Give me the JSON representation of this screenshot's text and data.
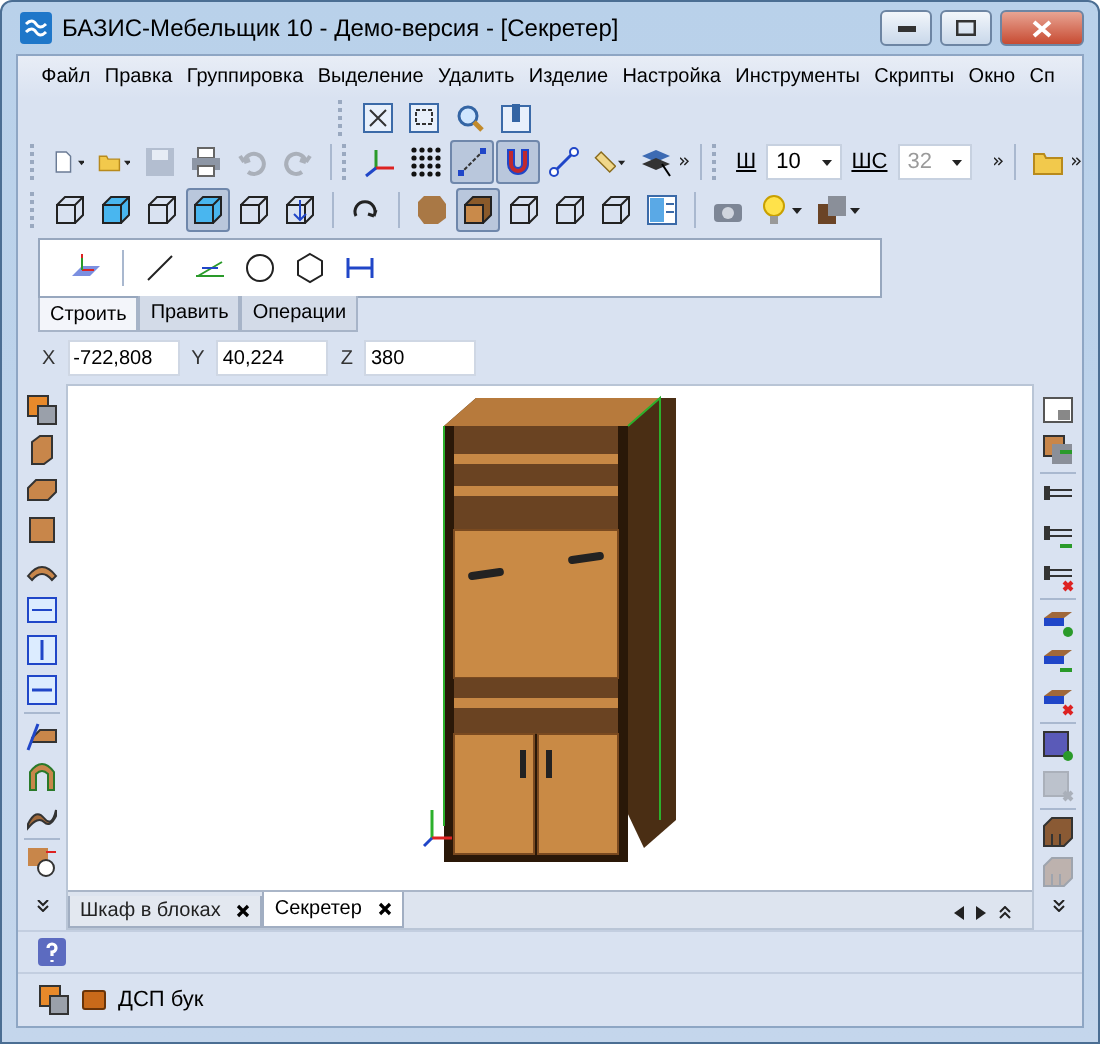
{
  "window": {
    "title": "БАЗИС-Мебельщик 10 - Демо-версия - [Секретер]"
  },
  "menu": [
    "Файл",
    "Правка",
    "Группировка",
    "Выделение",
    "Удалить",
    "Изделие",
    "Настройка",
    "Инструменты",
    "Скрипты",
    "Окно",
    "Сп"
  ],
  "toolbar_top": [
    {
      "kind": "fit",
      "pressed": false
    },
    {
      "kind": "zoomwin",
      "pressed": false
    },
    {
      "kind": "zoom",
      "pressed": false
    },
    {
      "kind": "pan",
      "pressed": false
    }
  ],
  "toolbar_file": [
    {
      "kind": "document",
      "pressed": false,
      "menu": true
    },
    {
      "kind": "folder",
      "pressed": false,
      "menu": true
    },
    {
      "kind": "floppy",
      "pressed": false,
      "disabled": true
    },
    {
      "kind": "printer",
      "pressed": false
    },
    {
      "kind": "undo",
      "pressed": false,
      "disabled": true
    },
    {
      "kind": "redo",
      "pressed": false,
      "disabled": true
    }
  ],
  "toolbar_snap": [
    {
      "kind": "axes",
      "pressed": false
    },
    {
      "kind": "dots",
      "pressed": false
    },
    {
      "kind": "snap",
      "pressed": true
    },
    {
      "kind": "magnet",
      "pressed": true
    },
    {
      "kind": "segment",
      "pressed": false
    },
    {
      "kind": "ruler",
      "pressed": false,
      "menu": true
    },
    {
      "kind": "layers",
      "pressed": false
    }
  ],
  "step_fields": [
    {
      "label": "Ш",
      "value": "10",
      "disabled": false
    },
    {
      "label": "ШС",
      "value": "32",
      "disabled": true
    }
  ],
  "toolbar_view": [
    {
      "kind": "wirecube",
      "pressed": false
    },
    {
      "kind": "bluecube",
      "pressed": false
    },
    {
      "kind": "wirecube",
      "pressed": false
    },
    {
      "kind": "bluecube",
      "pressed": true
    },
    {
      "kind": "wirecube",
      "pressed": false
    },
    {
      "kind": "cubearrows",
      "pressed": false
    },
    {
      "kind": "rotate",
      "pressed": false
    },
    {
      "kind": "woodtexture",
      "pressed": false
    },
    {
      "kind": "woodcube",
      "pressed": true
    },
    {
      "kind": "wirecube",
      "pressed": false
    },
    {
      "kind": "wirecube",
      "pressed": false
    },
    {
      "kind": "wirecube",
      "pressed": false
    },
    {
      "kind": "panels",
      "pressed": false
    },
    {
      "kind": "camera",
      "pressed": false
    },
    {
      "kind": "bulb",
      "pressed": false,
      "menu": true
    },
    {
      "kind": "boxes",
      "pressed": false,
      "menu": true
    }
  ],
  "draw_tools": [
    {
      "kind": "plane"
    },
    {
      "kind": "line"
    },
    {
      "kind": "angle"
    },
    {
      "kind": "circle"
    },
    {
      "kind": "hexagon"
    },
    {
      "kind": "dimension"
    }
  ],
  "draw_tabs": [
    {
      "label": "Строить",
      "selected": true
    },
    {
      "label": "Править",
      "selected": false
    },
    {
      "label": "Операции",
      "selected": false
    }
  ],
  "coordinates": [
    {
      "label": "X",
      "value": "-722,808"
    },
    {
      "label": "Y",
      "value": "40,224"
    },
    {
      "label": "Z",
      "value": "380"
    }
  ],
  "left_toolbar": [
    {
      "kind": "stack"
    },
    {
      "kind": "post"
    },
    {
      "kind": "plank"
    },
    {
      "kind": "block"
    },
    {
      "kind": "arc"
    },
    {
      "kind": "fitwidth"
    },
    {
      "kind": "fitheight"
    },
    {
      "kind": "fitdepth"
    },
    {
      "kind": "bluebox"
    },
    {
      "kind": "arch"
    },
    {
      "kind": "wave"
    },
    {
      "kind": "timer"
    }
  ],
  "right_toolbar": [
    {
      "kind": "window",
      "disabled": false
    },
    {
      "kind": "panelarrow",
      "disabled": false
    },
    {
      "kind": "screw",
      "disabled": false
    },
    {
      "kind": "screwadd",
      "disabled": false
    },
    {
      "kind": "screwdel",
      "disabled": false
    },
    {
      "kind": "shelfadd",
      "disabled": false
    },
    {
      "kind": "shelfmove",
      "disabled": false
    },
    {
      "kind": "shelfdel",
      "disabled": false
    },
    {
      "kind": "boxadd",
      "disabled": false
    },
    {
      "kind": "boxdel",
      "disabled": true
    },
    {
      "kind": "drawer",
      "disabled": false
    },
    {
      "kind": "drawer",
      "disabled": true
    }
  ],
  "document_tabs": [
    {
      "label": "Шкаф в блоках",
      "selected": false
    },
    {
      "label": "Секретер",
      "selected": true
    }
  ],
  "status": {
    "material": "ДСП бук"
  }
}
